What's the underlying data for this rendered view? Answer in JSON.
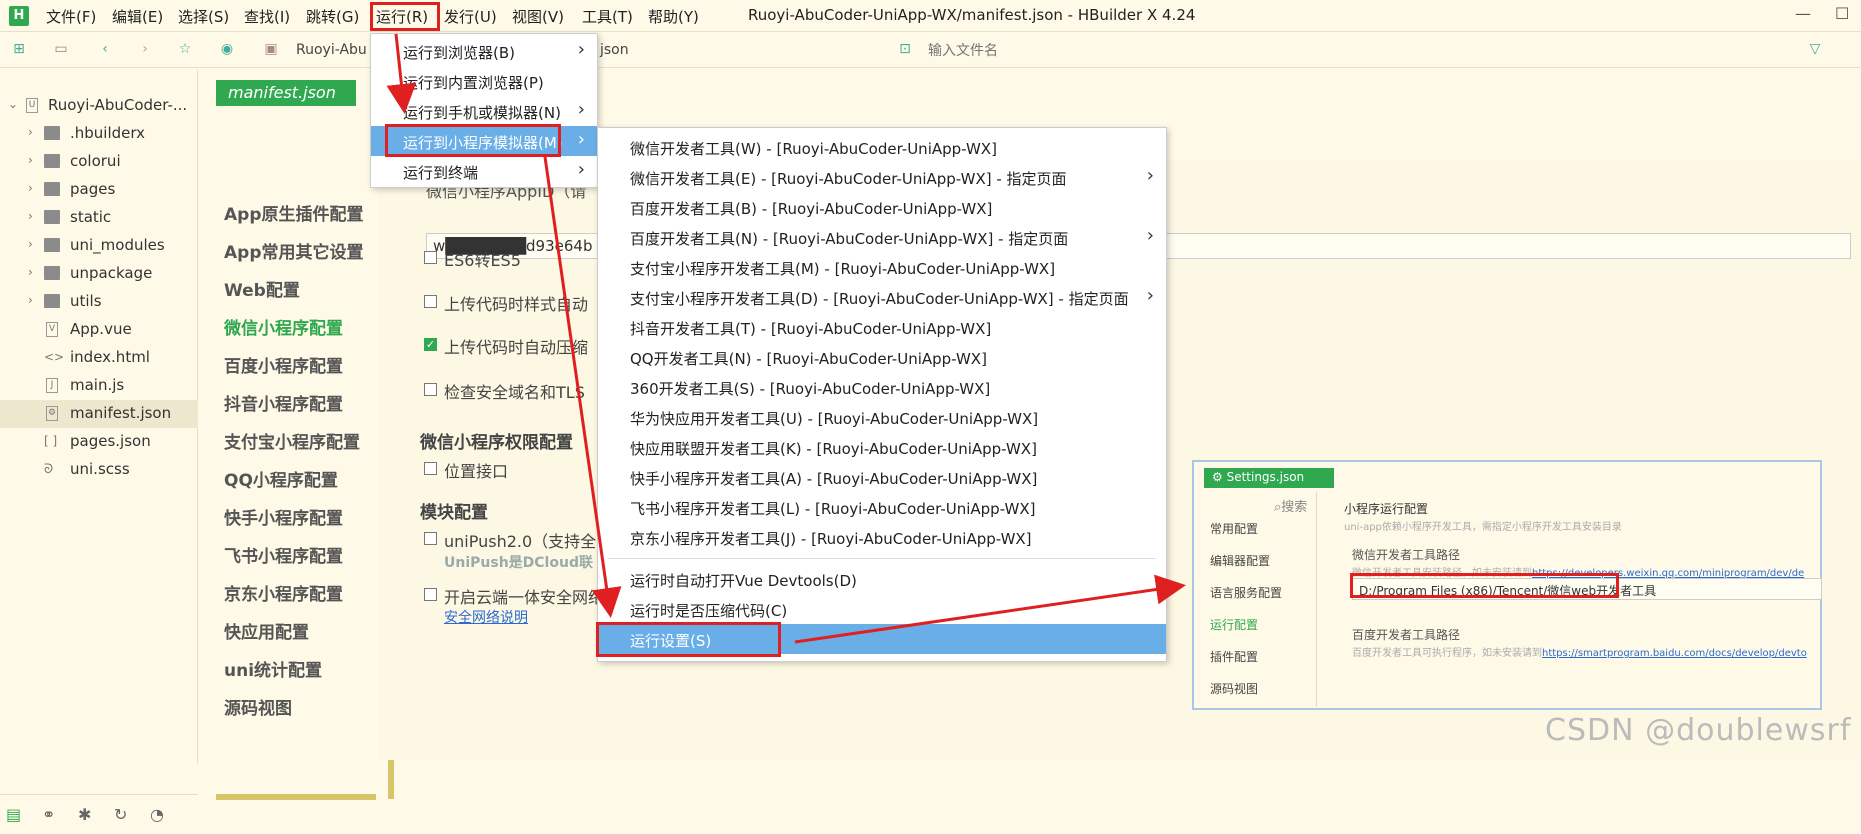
{
  "app": {
    "logo": "H",
    "window_title": "Ruoyi-AbuCoder-UniApp-WX/manifest.json - HBuilder X 4.24"
  },
  "menubar": [
    "文件(F)",
    "编辑(E)",
    "选择(S)",
    "查找(I)",
    "跳转(G)",
    "运行(R)",
    "发行(U)",
    "视图(V)",
    "工具(T)",
    "帮助(Y)"
  ],
  "toolbar": {
    "crumb_project": "Ruoyi-Abu",
    "crumb_file": "json",
    "filter_placeholder": "输入文件名"
  },
  "tree": {
    "root": "Ruoyi-AbuCoder-...",
    "items": [
      {
        "label": ".hbuilderx",
        "type": "folder"
      },
      {
        "label": "colorui",
        "type": "folder"
      },
      {
        "label": "pages",
        "type": "folder"
      },
      {
        "label": "static",
        "type": "folder"
      },
      {
        "label": "uni_modules",
        "type": "folder"
      },
      {
        "label": "unpackage",
        "type": "folder"
      },
      {
        "label": "utils",
        "type": "folder"
      },
      {
        "label": "App.vue",
        "type": "vue"
      },
      {
        "label": "index.html",
        "type": "html"
      },
      {
        "label": "main.js",
        "type": "js"
      },
      {
        "label": "manifest.json",
        "type": "json"
      },
      {
        "label": "pages.json",
        "type": "json"
      },
      {
        "label": "uni.scss",
        "type": "scss"
      }
    ]
  },
  "editor": {
    "tab": "manifest.json",
    "nav": [
      "App原生插件配置",
      "App常用其它设置",
      "Web配置",
      "微信小程序配置",
      "百度小程序配置",
      "抖音小程序配置",
      "支付宝小程序配置",
      "QQ小程序配置",
      "快手小程序配置",
      "飞书小程序配置",
      "京东小程序配置",
      "快应用配置",
      "uni统计配置",
      "源码视图"
    ],
    "active_nav": "微信小程序配置",
    "appid_label": "微信小程序AppID（请",
    "appid_value": "w███████d93e64b",
    "checks": [
      {
        "label": "ES6转ES5",
        "checked": false
      },
      {
        "label": "上传代码时样式自动",
        "checked": false
      },
      {
        "label": "上传代码时自动压缩",
        "checked": true
      },
      {
        "label": "检查安全域名和TLS",
        "checked": false
      }
    ],
    "perm_title": "微信小程序权限配置",
    "perm_check": "位置接口",
    "module_title": "模块配置",
    "unipush": "uniPush2.0（支持全",
    "unipush_note": "UniPush是DCloud联",
    "security": "开启云端一体安全网络",
    "security_link": "安全网络说明"
  },
  "run_menu": [
    {
      "label": "运行到浏览器(B)",
      "sub": true
    },
    {
      "label": "运行到内置浏览器(P)",
      "sub": false
    },
    {
      "label": "运行到手机或模拟器(N)",
      "sub": true
    },
    {
      "label": "运行到小程序模拟器(M)",
      "sub": true
    },
    {
      "label": "运行到终端",
      "sub": true
    }
  ],
  "mini_menu": [
    {
      "label": "微信开发者工具(W) - [Ruoyi-AbuCoder-UniApp-WX]",
      "sub": false
    },
    {
      "label": "微信开发者工具(E) - [Ruoyi-AbuCoder-UniApp-WX] - 指定页面",
      "sub": true
    },
    {
      "label": "百度开发者工具(B) - [Ruoyi-AbuCoder-UniApp-WX]",
      "sub": false
    },
    {
      "label": "百度开发者工具(N) - [Ruoyi-AbuCoder-UniApp-WX] - 指定页面",
      "sub": true
    },
    {
      "label": "支付宝小程序开发者工具(M) - [Ruoyi-AbuCoder-UniApp-WX]",
      "sub": false
    },
    {
      "label": "支付宝小程序开发者工具(D) - [Ruoyi-AbuCoder-UniApp-WX] - 指定页面",
      "sub": true
    },
    {
      "label": "抖音开发者工具(T) - [Ruoyi-AbuCoder-UniApp-WX]",
      "sub": false
    },
    {
      "label": "QQ开发者工具(N) - [Ruoyi-AbuCoder-UniApp-WX]",
      "sub": false
    },
    {
      "label": "360开发者工具(S) - [Ruoyi-AbuCoder-UniApp-WX]",
      "sub": false
    },
    {
      "label": "华为快应用开发者工具(U) - [Ruoyi-AbuCoder-UniApp-WX]",
      "sub": false
    },
    {
      "label": "快应用联盟开发者工具(K) - [Ruoyi-AbuCoder-UniApp-WX]",
      "sub": false
    },
    {
      "label": "快手小程序开发者工具(A) - [Ruoyi-AbuCoder-UniApp-WX]",
      "sub": false
    },
    {
      "label": "飞书小程序开发者工具(L) - [Ruoyi-AbuCoder-UniApp-WX]",
      "sub": false
    },
    {
      "label": "京东小程序开发者工具(J) - [Ruoyi-AbuCoder-UniApp-WX]",
      "sub": false
    }
  ],
  "mini_menu_extra": [
    "运行时自动打开Vue Devtools(D)",
    "运行时是否压缩代码(C)",
    "运行设置(S)"
  ],
  "settings": {
    "tab": "Settings.json",
    "search": "搜索",
    "nav": [
      "常用配置",
      "编辑器配置",
      "语言服务配置",
      "运行配置",
      "插件配置",
      "源码视图"
    ],
    "active": "运行配置",
    "title": "小程序运行配置",
    "subtitle": "uni-app依赖小程序开发工具，需指定小程序开发工具安装目录",
    "wx_label": "微信开发者工具路径",
    "wx_note": "微信开发者工具安装路径，如未安装请到",
    "wx_link": "https://developers.weixin.qq.com/miniprogram/dev/de",
    "wx_path": "D:/Program Files (x86)/Tencent/微信web开发者工具",
    "bd_label": "百度开发者工具路径",
    "bd_note": "百度开发者工具可执行程序，如未安装请到",
    "bd_link": "https://smartprogram.baidu.com/docs/develop/devto"
  },
  "watermark": "CSDN @doublewsrf",
  "colors": {
    "accent": "#2fa84f",
    "highlight": "#6aaee8",
    "annotation": "#e02020"
  }
}
